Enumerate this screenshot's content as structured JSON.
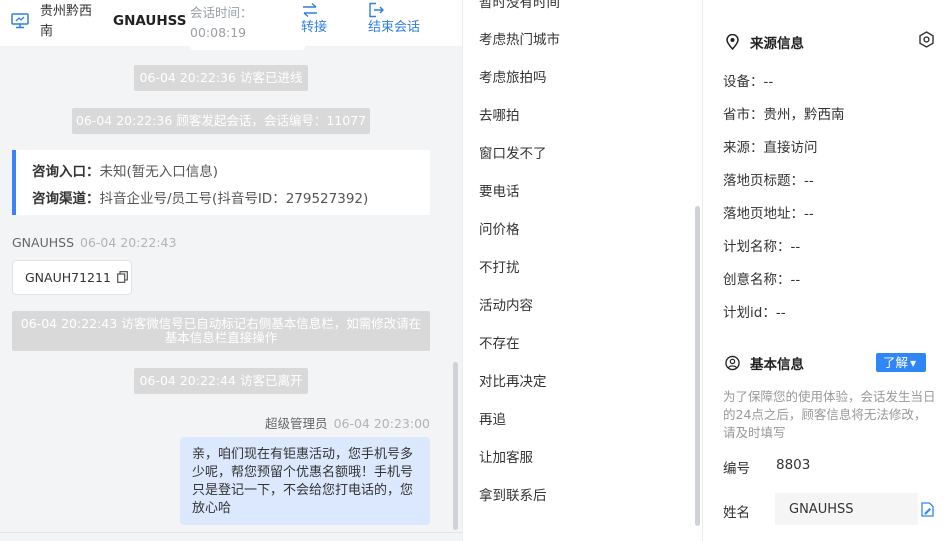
{
  "header": {
    "region": "贵州黔西南",
    "customer_name": "GNAUHSS",
    "session_time_label": "会话时间：",
    "session_time_value": "00:08:19",
    "transfer_label": "转接",
    "end_label": "结束会话"
  },
  "messages": {
    "sys_enter": "06-04 20:22:36 访客已进线",
    "sys_start": "06-04 20:22:36 顾客发起会话，会话编号：11077",
    "entry_label": "咨询入口：",
    "entry_value": "未知(暂无入口信息)",
    "channel_label": "咨询渠道：",
    "channel_value": "抖音企业号/员工号(抖音号ID：279527392)",
    "customer_sender": "GNAUHSS",
    "customer_time": "06-04 20:22:43",
    "customer_text": "GNAUH71211",
    "sys_wechat": "06-04 20:22:43 访客微信号已自动标记右侧基本信息栏，如需修改请在基本信息栏直接操作",
    "sys_leave": "06-04 20:22:44 访客已离开",
    "agent_sender": "超级管理员",
    "agent_time": "06-04 20:23:00",
    "agent_text": "亲，咱们现在有钜惠活动，您手机号多少呢，帮您预留个优惠名额哦！手机号只是登记一下，不会给您打电话的，您放心哈"
  },
  "quick_replies": [
    "暂时没有时间",
    "考虑热门城市",
    "考虑旅拍吗",
    "去哪拍",
    "窗口发不了",
    "要电话",
    "问价格",
    "不打扰",
    "活动内容",
    "不存在",
    "对比再决定",
    "再追",
    "让加客服",
    "拿到联系后"
  ],
  "source_info": {
    "title": "来源信息",
    "fields": [
      "设备：--",
      "省市：贵州，黔西南",
      "来源：直接访问",
      "落地页标题：--",
      "落地页地址：--",
      "计划名称：--",
      "创意名称：--",
      "计划id：--"
    ]
  },
  "basic_info": {
    "title": "基本信息",
    "learn_label": "了解",
    "notice": "为了保障您的使用体验，会话发生当日的24点之后，顾客信息将无法修改，请及时填写",
    "id_label": "编号",
    "id_value": "8803",
    "name_label": "姓名",
    "name_value": "GNAUHSS"
  },
  "colors": {
    "accent": "#2f86f6",
    "agent_bubble": "#dbe8fd",
    "system_msg": "#d9d9d9"
  }
}
